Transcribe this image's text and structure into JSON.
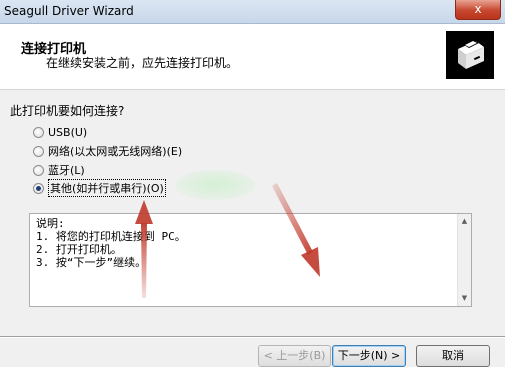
{
  "window": {
    "title": "Seagull Driver Wizard",
    "close_glyph": "x"
  },
  "header": {
    "title": "连接打印机",
    "subtitle": "在继续安装之前，应先连接打印机。",
    "icon": "printer-icon"
  },
  "question": "此打印机要如何连接?",
  "options": [
    {
      "label": "USB(U)",
      "checked": false
    },
    {
      "label": "网络(以太网或无线网络)(E)",
      "checked": false
    },
    {
      "label": "蓝牙(L)",
      "checked": false
    },
    {
      "label": "其他(如并行或串行)(O)",
      "checked": true
    }
  ],
  "description": {
    "lines": [
      "说明:",
      "1. 将您的打印机连接到 PC。",
      "2. 打开打印机。",
      "3. 按“下一步”继续。"
    ]
  },
  "buttons": {
    "back": "< 上一步(B)",
    "next": "下一步(N) >",
    "cancel": "取消"
  },
  "colors": {
    "annotation_arrow": "#c0392b",
    "header_bg": "#ffffff",
    "dialog_bg": "#f0f0f0"
  }
}
